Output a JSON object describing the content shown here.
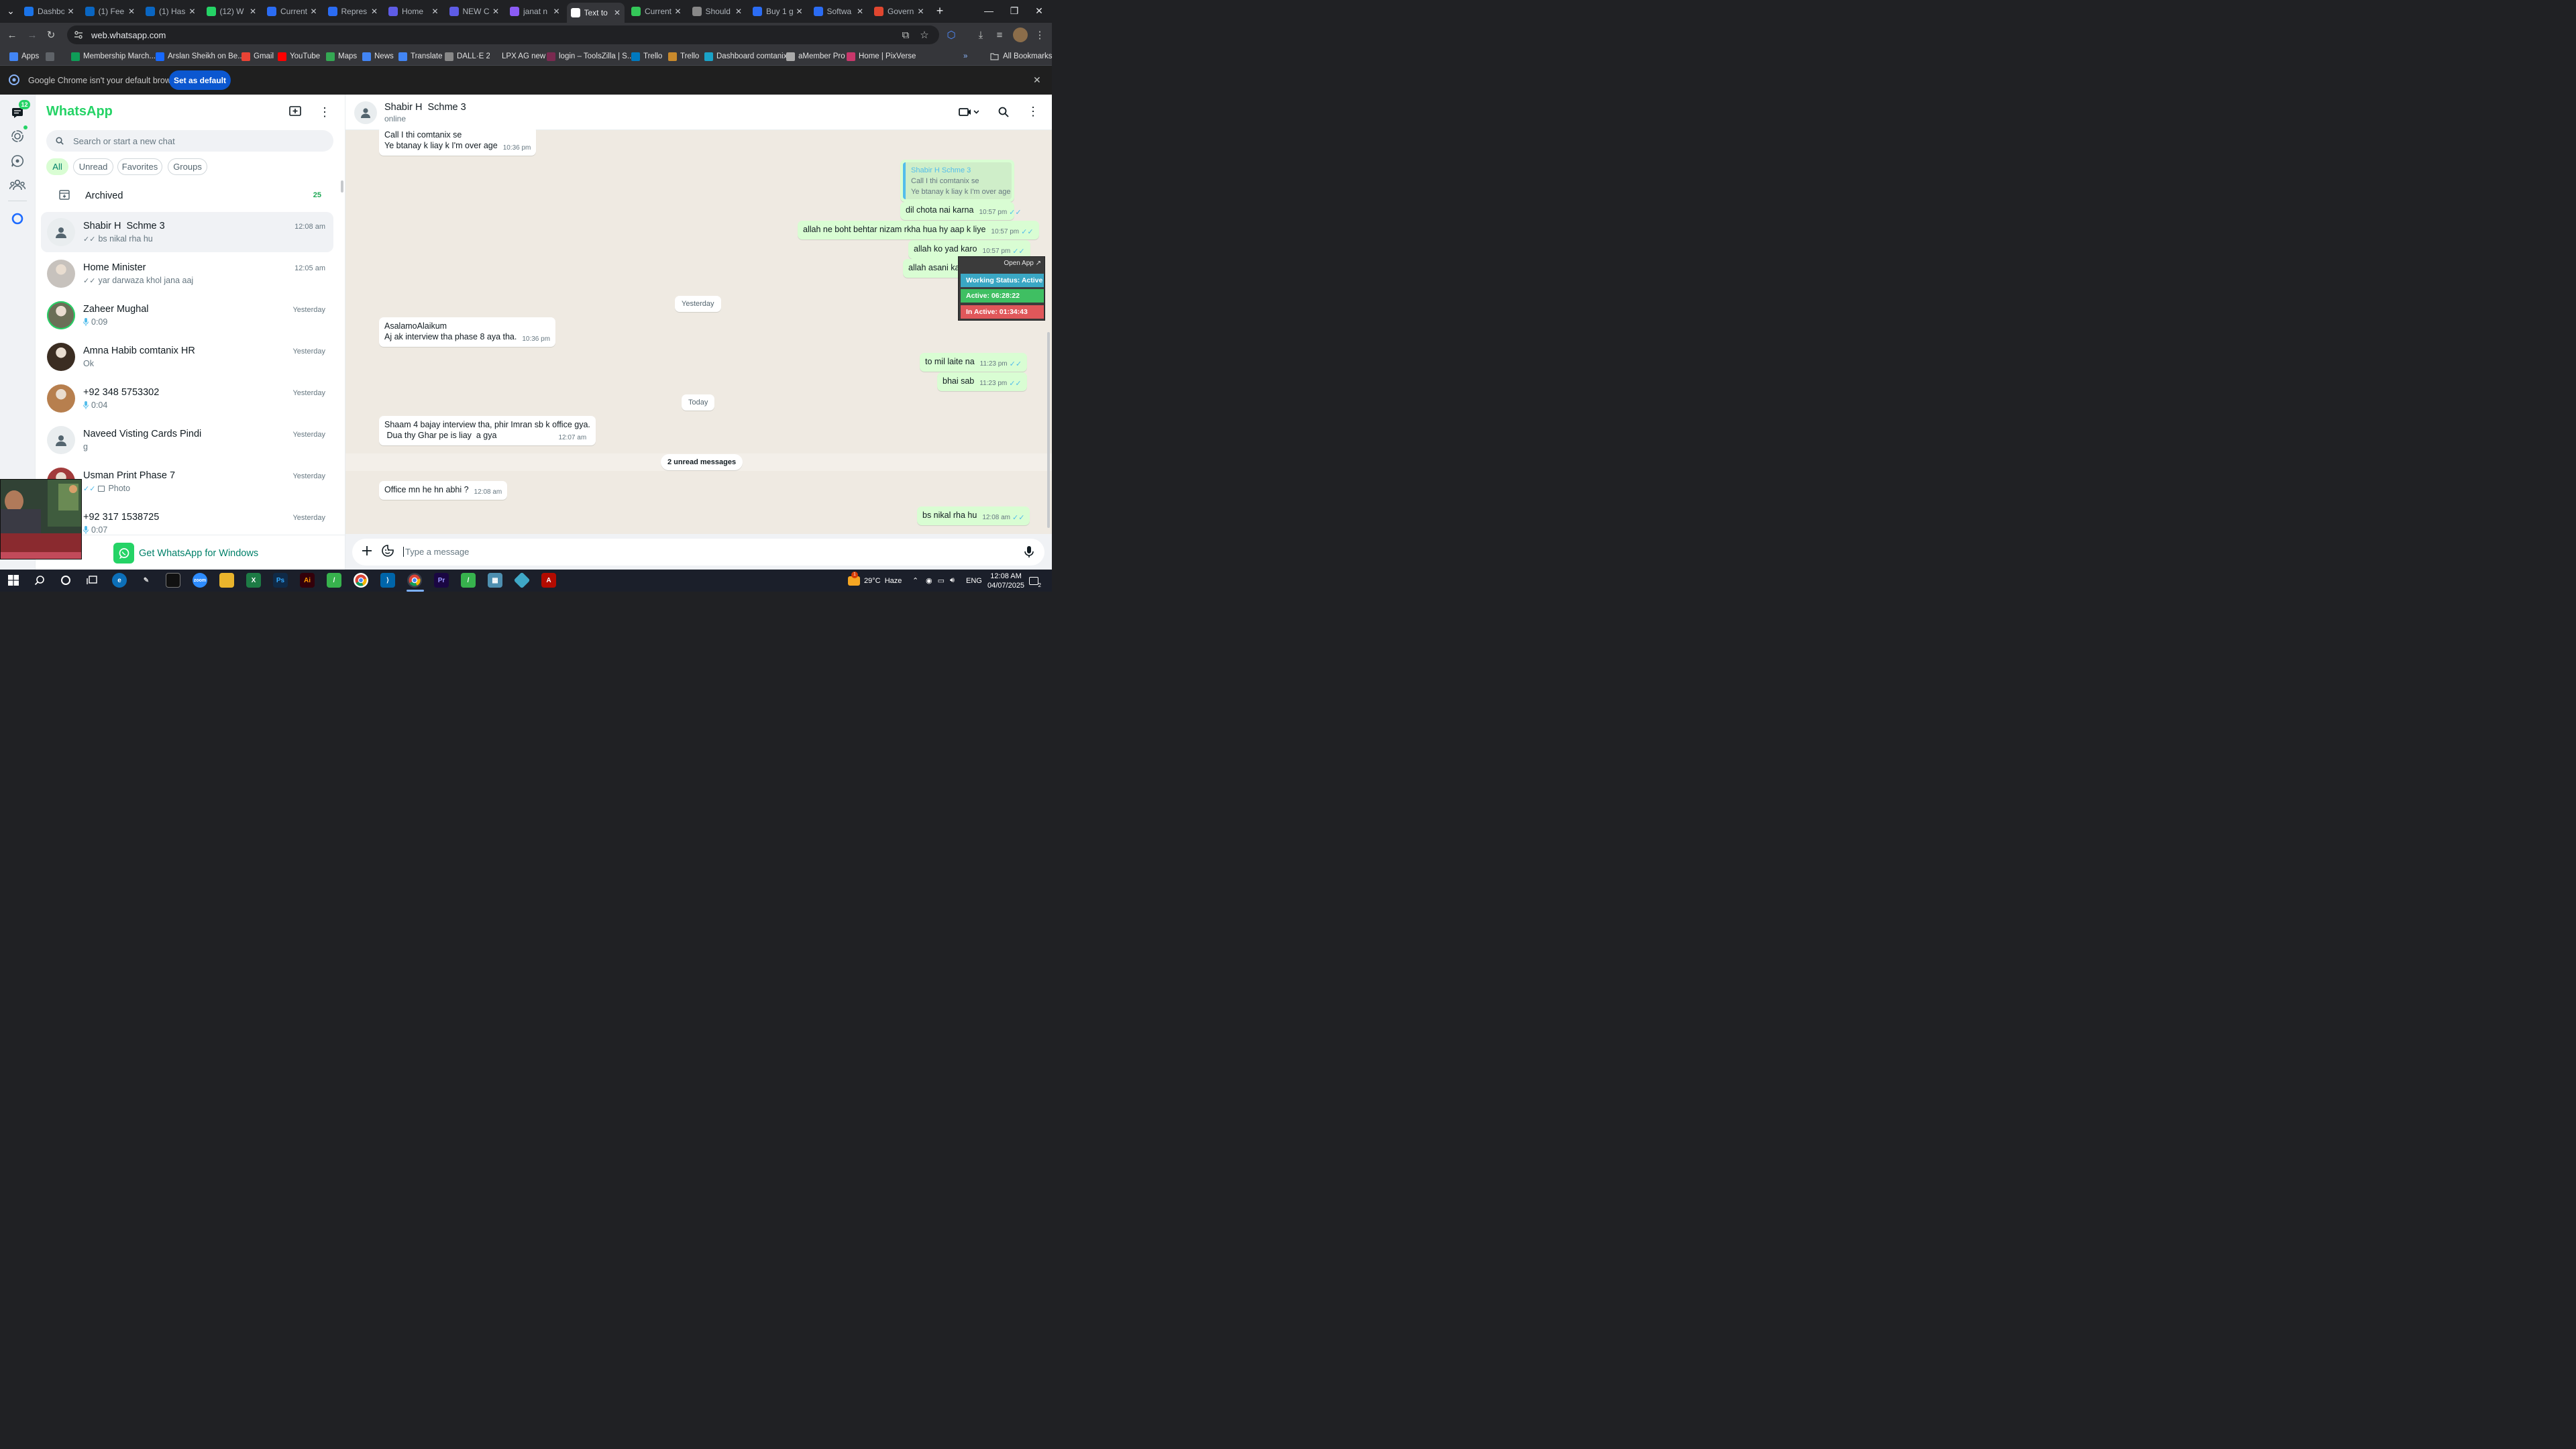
{
  "browser": {
    "tabs": [
      {
        "title": "Dashbo",
        "color": "#1a73e8",
        "active": false
      },
      {
        "title": "(1) Fee",
        "color": "#0a66c2",
        "active": false
      },
      {
        "title": "(1) Has",
        "color": "#0a66c2",
        "active": false
      },
      {
        "title": "(12) W",
        "color": "#25d366",
        "active": false
      },
      {
        "title": "Current",
        "color": "#2b6cf3",
        "active": false
      },
      {
        "title": "Repres",
        "color": "#2b6cf3",
        "active": false
      },
      {
        "title": "Home",
        "color": "#5e5ce6",
        "active": false
      },
      {
        "title": "NEW C",
        "color": "#5e5ce6",
        "active": false
      },
      {
        "title": "janat n",
        "color": "#8b5cf6",
        "active": false
      },
      {
        "title": "Text to",
        "color": "#ffffff",
        "active": true
      },
      {
        "title": "Current",
        "color": "#34c759",
        "active": false
      },
      {
        "title": "Should",
        "color": "#888888",
        "active": false
      },
      {
        "title": "Buy 1 g",
        "color": "#2b6cf3",
        "active": false
      },
      {
        "title": "Softwa",
        "color": "#2b6cf3",
        "active": false
      },
      {
        "title": "Govern",
        "color": "#e0462f",
        "active": false
      }
    ],
    "new_tab": "+",
    "url": "web.whatsapp.com",
    "bookmarks": [
      {
        "label": "Apps",
        "color": "#4285f4"
      },
      {
        "label": "",
        "color": "#5f6368"
      },
      {
        "label": "Membership March...",
        "color": "#0f9d58"
      },
      {
        "label": "Arslan Sheikh on Be...",
        "color": "#1769ff"
      },
      {
        "label": "Gmail",
        "color": "#ea4335"
      },
      {
        "label": "YouTube",
        "color": "#ff0000"
      },
      {
        "label": "Maps",
        "color": "#34a853"
      },
      {
        "label": "News",
        "color": "#4285f4"
      },
      {
        "label": "Translate",
        "color": "#4285f4"
      },
      {
        "label": "DALL·E 2",
        "color": "#888888"
      },
      {
        "label": "LPX AG new",
        "color": "#35363a"
      },
      {
        "label": "login – ToolsZilla | S...",
        "color": "#7a2a50"
      },
      {
        "label": "Trello",
        "color": "#0079bf"
      },
      {
        "label": "Trello",
        "color": "#c98a2c"
      },
      {
        "label": "Dashboard comtanix",
        "color": "#1aa3c8"
      },
      {
        "label": "aMember Pro",
        "color": "#aaaaaa"
      },
      {
        "label": "Home | PixVerse",
        "color": "#c8376b"
      }
    ],
    "all_bookmarks": "All Bookmarks",
    "infobar_text": "Google Chrome isn't your default browser",
    "infobar_button": "Set as default"
  },
  "rail": {
    "chats_badge": "12"
  },
  "sidebar": {
    "brand": "WhatsApp",
    "search_placeholder": "Search or start a new chat",
    "filters": [
      "All",
      "Unread",
      "Favorites",
      "Groups"
    ],
    "archived_label": "Archived",
    "archived_count": "25",
    "chats": [
      {
        "name": "Shabir H  Schme 3",
        "preview": "bs nikal rha hu",
        "time": "12:08 am",
        "prefix": "ticks",
        "avatar": "blank",
        "selected": true
      },
      {
        "name": "Home Minister",
        "preview": "yar darwaza khol jana aaj",
        "time": "12:05 am",
        "prefix": "ticks",
        "avatar": "#c7c2bd",
        "selected": false
      },
      {
        "name": "Zaheer Mughal",
        "preview": "0:09",
        "time": "Yesterday",
        "prefix": "mic",
        "avatar": "#6b6f57",
        "selected": false
      },
      {
        "name": "Amna Habib comtanix HR",
        "preview": "Ok",
        "time": "Yesterday",
        "prefix": "",
        "avatar": "#3b2d22",
        "selected": false
      },
      {
        "name": "+92 348 5753302",
        "preview": "0:04",
        "time": "Yesterday",
        "prefix": "mic",
        "avatar": "#b77f4e",
        "selected": false
      },
      {
        "name": "Naveed Visting Cards Pindi",
        "preview": "g",
        "time": "Yesterday",
        "prefix": "",
        "avatar": "blank",
        "selected": false
      },
      {
        "name": "Usman Print Phase 7",
        "preview": "Photo",
        "time": "Yesterday",
        "prefix": "photo",
        "avatar": "#a23b3b",
        "selected": false
      },
      {
        "name": "+92 317 1538725",
        "preview": "0:07",
        "time": "Yesterday",
        "prefix": "mic",
        "avatar": "#4b5563",
        "selected": false
      }
    ],
    "get_app": "Get WhatsApp for Windows"
  },
  "chat": {
    "contact_name": "Shabir H  Schme 3",
    "status": "online",
    "quote_name": "Shabir H Schme 3",
    "quote_line1": "Call I thi comtanix se",
    "quote_line2": "Ye btanay k liay k I'm over age",
    "messages": {
      "m1_line1": "Call I thi comtanix se",
      "m1_line2": "Ye btanay k liay k I'm over age",
      "m1_time": "10:36 pm",
      "m2": "dil chota nai karna",
      "m2_time": "10:57 pm",
      "m3": "allah ne boht behtar nizam rkha hua hy aap k liye",
      "m3_time": "10:57 pm",
      "m4": "allah ko yad karo",
      "m4_time": "10:57 pm",
      "m5": "allah asani kare ga",
      "day1": "Yesterday",
      "m6_line1": "AsalamoAlaikum",
      "m6_line2": "Aj ak interview tha phase 8 aya tha.",
      "m6_time": "10:36 pm",
      "m7": "to mil laite na",
      "m7_time": "11:23 pm",
      "m8": "bhai sab",
      "m8_time": "11:23 pm",
      "day2": "Today",
      "m9_line1": "Shaam 4 bajay interview tha, phir Imran sb k office gya.",
      "m9_line2": " Dua thy Ghar pe is liay  a gya",
      "m9_time": "12:07 am",
      "unread": "2 unread messages",
      "m10": "Office mn he hn abhi ?",
      "m10_time": "12:08 am",
      "m11": "bs nikal rha hu",
      "m11_time": "12:08 am"
    },
    "composer_placeholder": "Type a message"
  },
  "widget": {
    "open_app": "Open App ↗",
    "status": "Working Status: Active",
    "active": "Active: 06:28:22",
    "inactive": "In Active: 01:34:43",
    "colors": {
      "status": "#3aa7c4",
      "active": "#3fbf62",
      "inactive": "#e0575a"
    }
  },
  "taskbar": {
    "weather_badge": "1",
    "weather": "29°C  Haze",
    "lang": "ENG",
    "time": "12:08 AM",
    "date": "04/07/2025",
    "notif_count": "2"
  }
}
